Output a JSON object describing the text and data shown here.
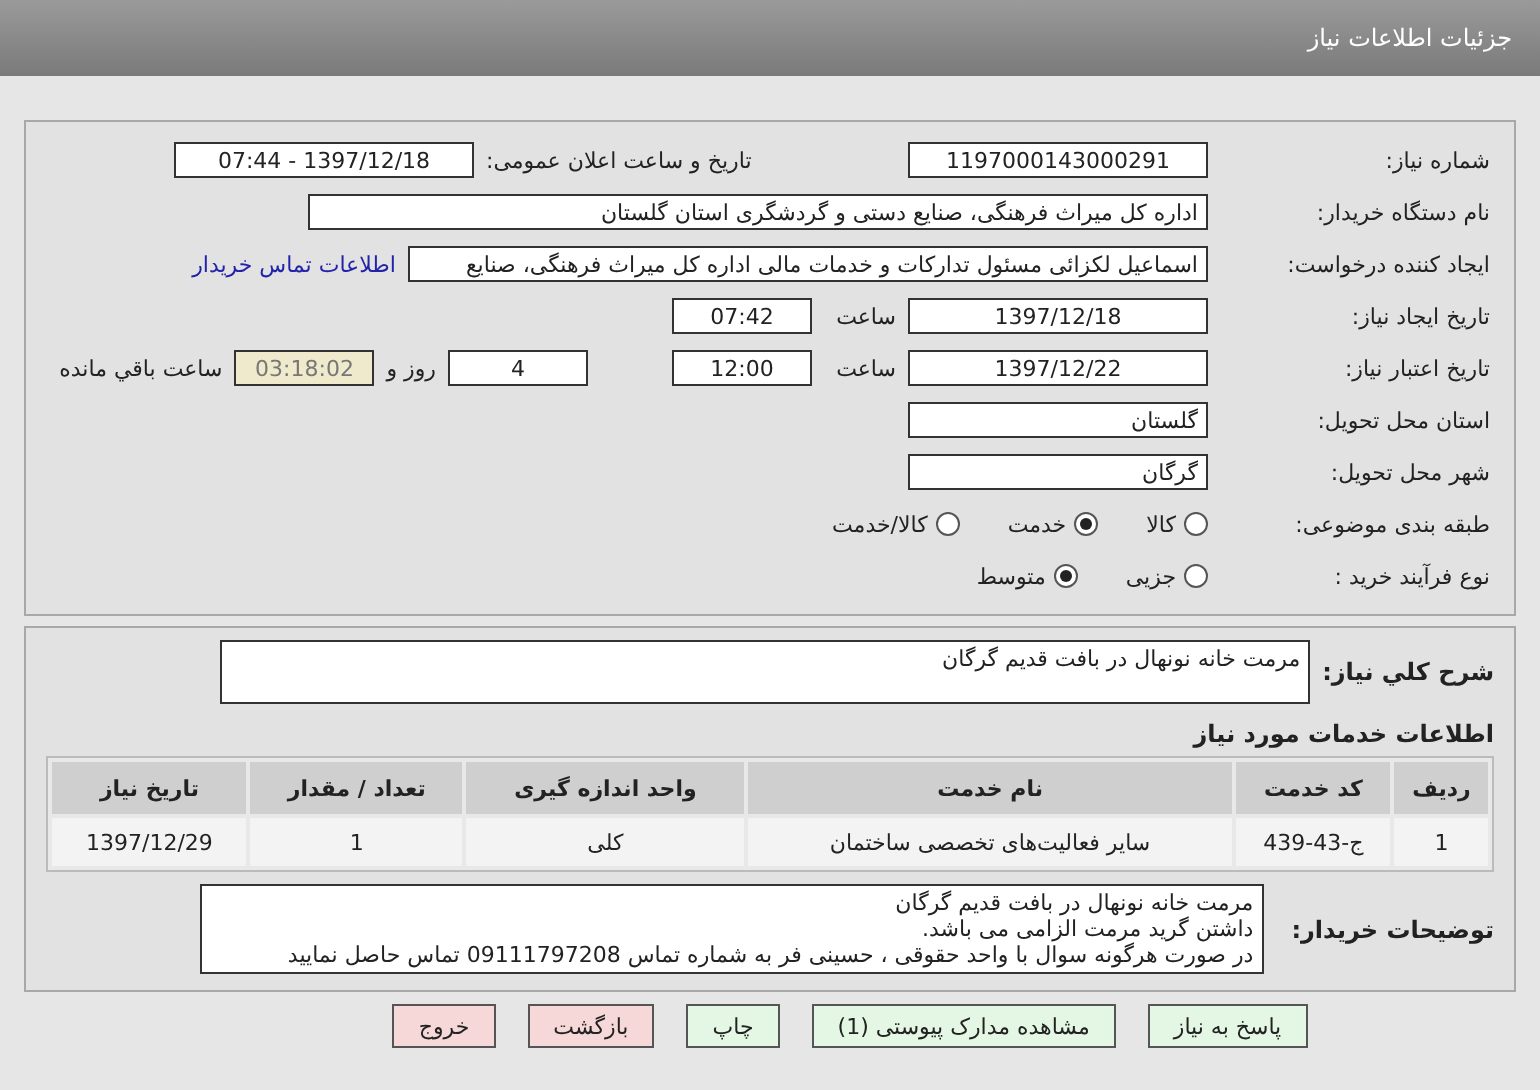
{
  "header": {
    "title": "جزئیات اطلاعات نیاز"
  },
  "need_number": {
    "label": "شماره نیاز:",
    "value": "1197000143000291"
  },
  "announce": {
    "label": "تاریخ و ساعت اعلان عمومی:",
    "value": "1397/12/18 - 07:44"
  },
  "buyer_org": {
    "label": "نام دستگاه خریدار:",
    "value": "اداره کل میراث فرهنگی، صنایع دستی و گردشگری استان گلستان"
  },
  "creator": {
    "label": "ایجاد کننده درخواست:",
    "value": "اسماعیل لکزائی مسئول تدارکات و خدمات مالی اداره کل میراث فرهنگی، صنایع",
    "link": "اطلاعات تماس خریدار"
  },
  "created": {
    "label": "تاریخ ایجاد نیاز:",
    "date": "1397/12/18",
    "time_label": "ساعت",
    "time": "07:42"
  },
  "validity": {
    "label": "تاریخ اعتبار نیاز:",
    "date": "1397/12/22",
    "time_label": "ساعت",
    "time": "12:00",
    "days": "4",
    "days_label": "روز و",
    "remaining": "03:18:02",
    "remaining_label": "ساعت باقي مانده"
  },
  "province": {
    "label": "استان محل تحویل:",
    "value": "گلستان"
  },
  "city": {
    "label": "شهر محل تحویل:",
    "value": "گرگان"
  },
  "category": {
    "label": "طبقه بندی موضوعی:",
    "options": [
      {
        "label": "کالا",
        "selected": false
      },
      {
        "label": "خدمت",
        "selected": true
      },
      {
        "label": "کالا/خدمت",
        "selected": false
      }
    ]
  },
  "process": {
    "label": "نوع فرآیند خرید :",
    "options": [
      {
        "label": "جزیی",
        "selected": false
      },
      {
        "label": "متوسط",
        "selected": true
      }
    ]
  },
  "summary": {
    "label": "شرح کلي نیاز:",
    "value": "مرمت خانه نونهال در بافت قدیم گرگان"
  },
  "services": {
    "title": "اطلاعات خدمات مورد نیاز",
    "columns": [
      "ردیف",
      "کد خدمت",
      "نام خدمت",
      "واحد اندازه گیری",
      "تعداد / مقدار",
      "تاریخ نیاز"
    ],
    "rows": [
      [
        "1",
        "ج-43-439",
        "سایر فعالیت‌های تخصصی ساختمان",
        "کلی",
        "1",
        "1397/12/29"
      ]
    ]
  },
  "buyer_notes": {
    "label": "توضیحات خریدار:",
    "lines": [
      "مرمت خانه نونهال در بافت قدیم گرگان",
      "داشتن گرید مرمت الزامی می باشد.",
      "در صورت هرگونه سوال با واحد حقوقی ، حسینی فر به شماره تماس 09111797208 تماس حاصل نمایید"
    ]
  },
  "buttons": [
    {
      "label": "پاسخ به نیاز",
      "kind": "primary"
    },
    {
      "label": "مشاهده مدارک پیوستی (1)",
      "kind": "primary"
    },
    {
      "label": "چاپ",
      "kind": "primary"
    },
    {
      "label": "بازگشت",
      "kind": "danger"
    },
    {
      "label": "خروج",
      "kind": "danger"
    }
  ]
}
